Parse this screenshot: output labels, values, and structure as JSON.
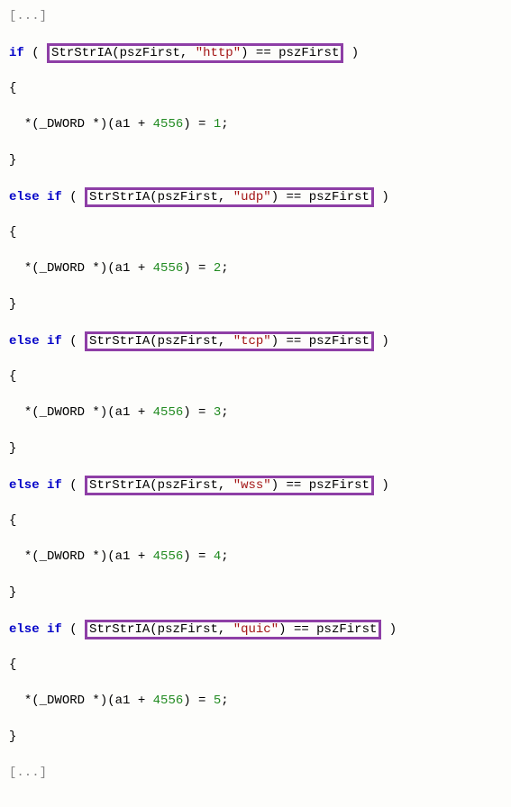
{
  "ellipsis_top": "[...]",
  "ellipsis_bottom": "[...]",
  "fn": "StrStrIA",
  "arg1": "pszFirst",
  "cmp_op": "==",
  "cmp_rhs": "pszFirst",
  "cast_prefix": "*(_DWORD *)(a1 + ",
  "offset": "4556",
  "cast_close": ") = ",
  "semicolon": ";",
  "kw_if": "if",
  "kw_else": "else",
  "brace_open": "{",
  "brace_close": "}",
  "blocks": [
    {
      "proto": "\"http\"",
      "value": "1"
    },
    {
      "proto": "\"udp\"",
      "value": "2"
    },
    {
      "proto": "\"tcp\"",
      "value": "3"
    },
    {
      "proto": "\"wss\"",
      "value": "4"
    },
    {
      "proto": "\"quic\"",
      "value": "5"
    }
  ]
}
